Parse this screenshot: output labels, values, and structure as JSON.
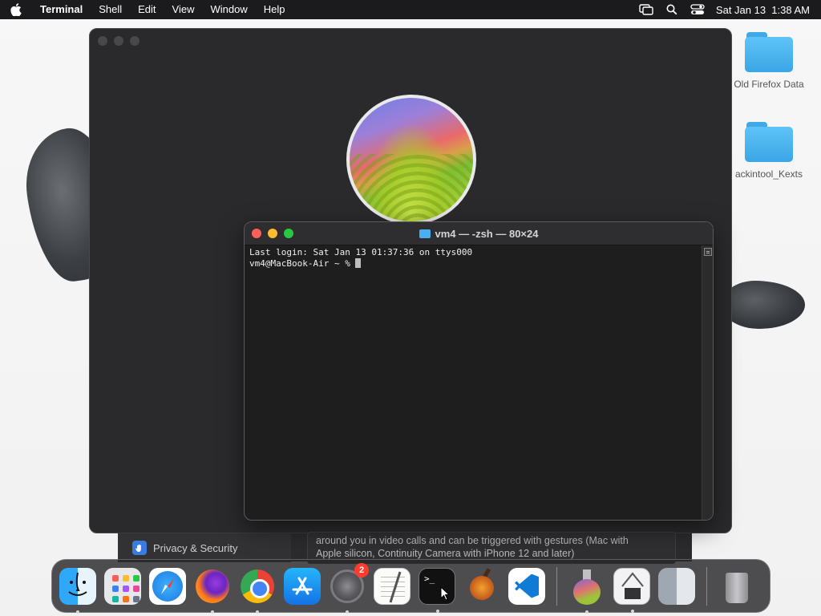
{
  "menubar": {
    "app_name": "Terminal",
    "menus": [
      "Shell",
      "Edit",
      "View",
      "Window",
      "Help"
    ],
    "datetime": "Sat Jan 13  1:38 AM",
    "icons": [
      "apple-icon",
      "screen-mirroring-icon",
      "spotlight-search-icon",
      "control-center-icon"
    ]
  },
  "desktop": {
    "items": [
      {
        "label": "Old Firefox Data",
        "icon": "folder-icon"
      },
      {
        "label": "ackintool_Kexts",
        "icon": "folder-icon"
      }
    ]
  },
  "terminal": {
    "title": "vm4 — -zsh — 80×24",
    "lines": [
      "Last login: Sat Jan 13 01:37:36 on ttys000",
      "vm4@MacBook-Air ~ % "
    ]
  },
  "settings": {
    "sidebar_item": "Privacy & Security",
    "description_line1": "around you in video calls and can be triggered with gestures (Mac with",
    "description_line2": "Apple silicon, Continuity Camera with iPhone 12 and later)"
  },
  "dock": {
    "items": [
      {
        "name": "Finder",
        "running": true
      },
      {
        "name": "Launchpad",
        "running": false
      },
      {
        "name": "Safari",
        "running": false
      },
      {
        "name": "Firefox",
        "running": true
      },
      {
        "name": "Google Chrome",
        "running": true
      },
      {
        "name": "App Store",
        "running": false
      },
      {
        "name": "System Settings",
        "running": true,
        "badge": "2"
      },
      {
        "name": "TextEdit",
        "running": false
      },
      {
        "name": "Terminal",
        "running": true
      },
      {
        "name": "GarageBand",
        "running": false
      },
      {
        "name": "Visual Studio Code",
        "running": false
      },
      {
        "name": "Install macOS Sonoma",
        "running": true
      },
      {
        "name": "System Information",
        "running": true
      },
      {
        "name": "Finder Downloads",
        "running": false
      },
      {
        "name": "Trash",
        "running": false
      }
    ]
  },
  "colors": {
    "close": "#ff5f57",
    "minimize": "#febc2e",
    "zoom": "#28c840",
    "badge": "#ff3b30"
  }
}
